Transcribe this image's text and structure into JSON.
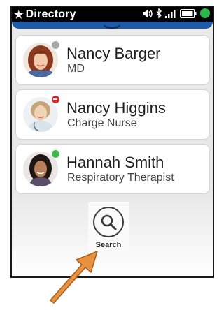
{
  "header": {
    "star": "★",
    "title": "Directory"
  },
  "status": {
    "presence_color": "#2db84a"
  },
  "contacts": [
    {
      "name": "Nancy Barger",
      "role": "MD",
      "status": "offline",
      "status_color": "#a9a9a9"
    },
    {
      "name": "Nancy Higgins",
      "role": "Charge Nurse",
      "status": "do-not-disturb",
      "status_color": "#d9262e"
    },
    {
      "name": "Hannah Smith",
      "role": "Respiratory Therapist",
      "status": "available",
      "status_color": "#3dbb4a"
    }
  ],
  "search": {
    "label": "Search",
    "icon": "search-icon"
  },
  "colors": {
    "accent": "#1d5aa7",
    "arrow": "#e8913e"
  }
}
